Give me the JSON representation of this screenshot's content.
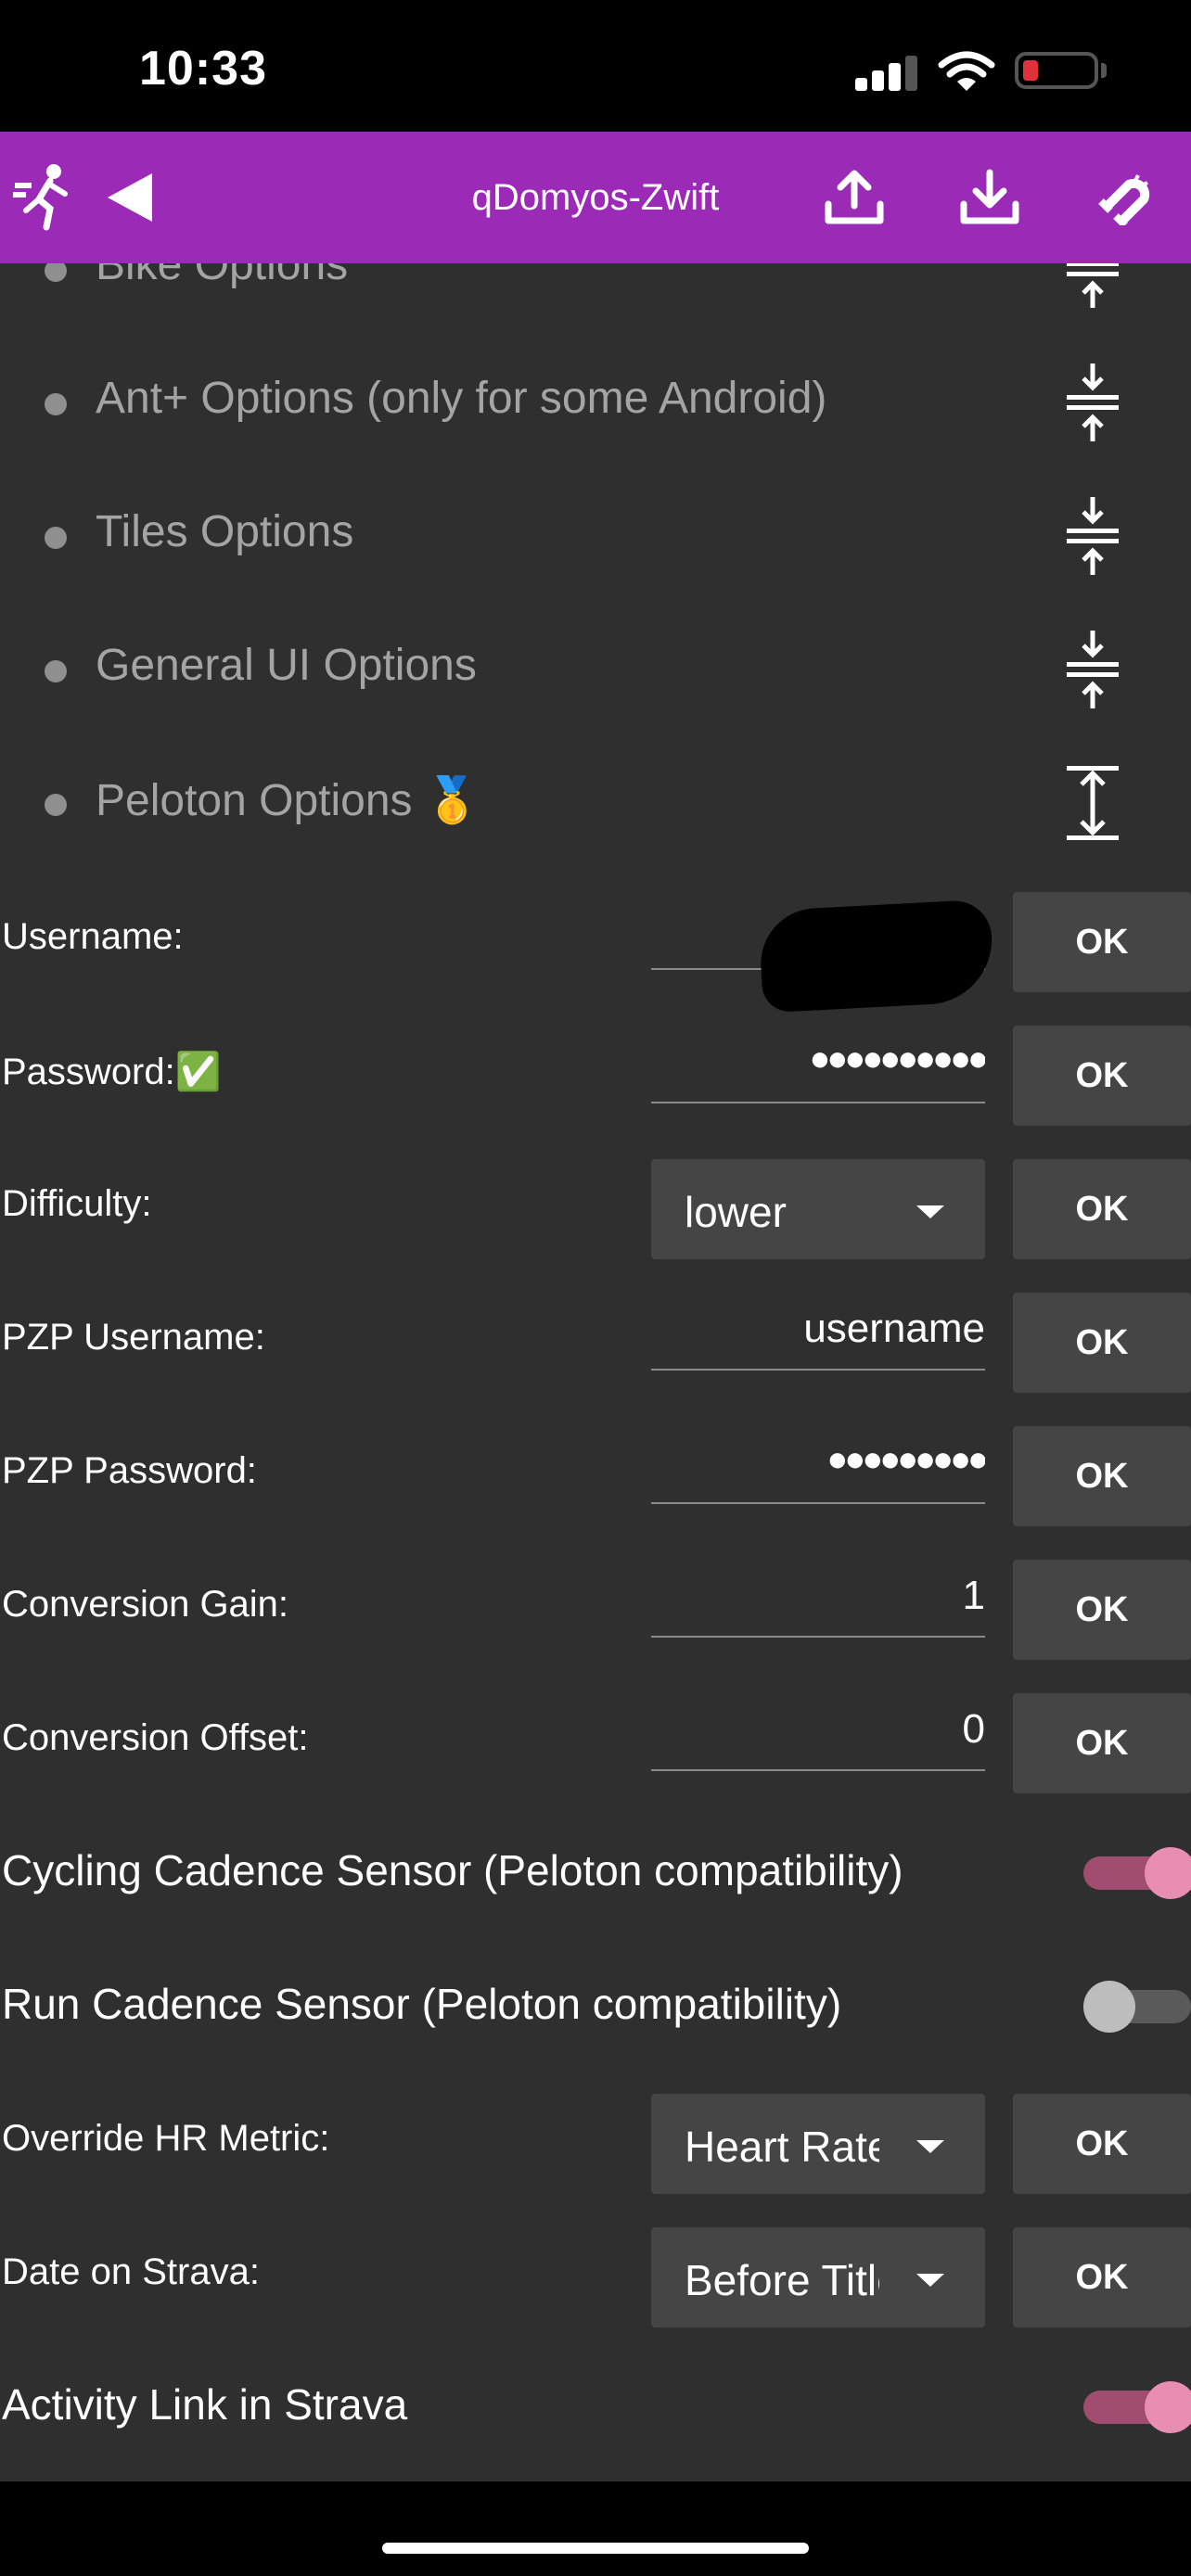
{
  "status_bar": {
    "time": "10:33"
  },
  "header": {
    "title": "qDomyos-Zwift"
  },
  "sections": [
    {
      "label": "Bike Options"
    },
    {
      "label": "Ant+ Options (only for some Android)"
    },
    {
      "label": "Tiles Options"
    },
    {
      "label": "General UI Options"
    },
    {
      "label": "Peloton Options 🥇"
    }
  ],
  "settings": {
    "username": {
      "label": "Username:",
      "ok": "OK"
    },
    "password": {
      "label": "Password:✅",
      "masked": "●●●●●●●●●●",
      "ok": "OK"
    },
    "difficulty": {
      "label": "Difficulty:",
      "value": "lower",
      "ok": "OK"
    },
    "pzp_username": {
      "label": "PZP Username:",
      "value": "username",
      "ok": "OK"
    },
    "pzp_password": {
      "label": "PZP Password:",
      "masked": "●●●●●●●●●",
      "ok": "OK"
    },
    "conversion_gain": {
      "label": "Conversion Gain:",
      "value": "1",
      "ok": "OK"
    },
    "conversion_offset": {
      "label": "Conversion Offset:",
      "value": "0",
      "ok": "OK"
    },
    "cycling_cadence": {
      "label": "Cycling Cadence Sensor (Peloton compatibility)",
      "enabled": true
    },
    "run_cadence": {
      "label": "Run Cadence Sensor (Peloton compatibility)",
      "enabled": false
    },
    "override_hr": {
      "label": "Override HR Metric:",
      "value": "Heart Rate",
      "ok": "OK"
    },
    "date_strava": {
      "label": "Date on Strava:",
      "value": "Before Title",
      "ok": "OK"
    },
    "activity_link": {
      "label": "Activity Link in Strava",
      "enabled": true
    }
  },
  "colors": {
    "header": "#9b2bb6",
    "background": "#2f2f2f",
    "switch_on": "#e98eb3",
    "button": "#454545"
  },
  "icons": {
    "header_left": [
      "runner-icon",
      "back-arrow-icon"
    ],
    "header_right": [
      "upload-icon",
      "download-icon",
      "magnet-icon"
    ],
    "section_collapsed": "compress-vertical-icon",
    "section_expanded": "expand-vertical-icon"
  }
}
